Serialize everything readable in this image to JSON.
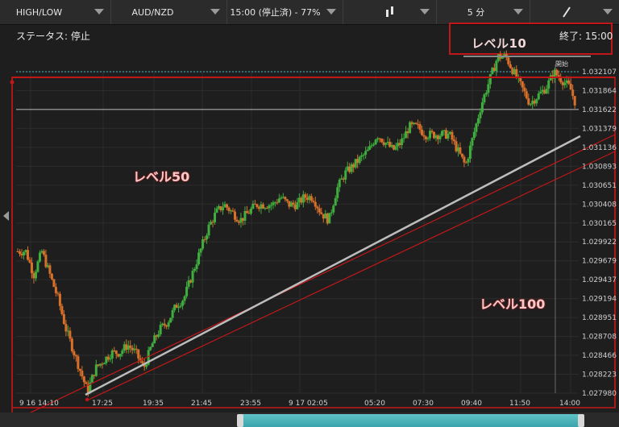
{
  "toolbar": {
    "type_label": "HIGH/LOW",
    "pair_label": "AUD/NZD",
    "expiry_label": "15:00 (停止済) - 77%",
    "timeframe_label": "5 分"
  },
  "status": {
    "status_text": "ステータス: 停止",
    "end_time_text": "終了: 15:00"
  },
  "annotations": {
    "level10": "レベル10",
    "level50": "レベル50",
    "level100": "レベル100",
    "start_marker": "開始"
  },
  "colors": {
    "background": "#1e1e1e",
    "up_candle": "#3fae3f",
    "down_candle": "#d8702a",
    "annotation_red": "#c01818",
    "trend_line": "#bdbdbd",
    "accent_teal": "#4ab4bc"
  },
  "chart_data": {
    "type": "candlestick",
    "title": "",
    "y_ticks": [
      "1.032107",
      "1.031864",
      "1.031622",
      "1.031379",
      "1.031136",
      "1.030893",
      "1.030651",
      "1.030408",
      "1.030165",
      "1.029922",
      "1.029679",
      "1.029437",
      "1.029194",
      "1.028951",
      "1.028708",
      "1.028466",
      "1.028223",
      "1.027980"
    ],
    "x_ticks": [
      "9 16 14:10",
      "17:25",
      "19:35",
      "21:45",
      "23:55",
      "9 17 02:05",
      "05:20",
      "07:30",
      "09:40",
      "11:50",
      "14:00"
    ],
    "ylim": [
      1.02798,
      1.032107
    ],
    "horizontal_lines": [
      1.032107,
      1.031622
    ],
    "price_path": [
      [
        0,
        1.0298
      ],
      [
        3,
        1.0298
      ],
      [
        6,
        1.0295
      ],
      [
        9,
        1.0298
      ],
      [
        12,
        1.0295
      ],
      [
        15,
        1.0292
      ],
      [
        18,
        1.0288
      ],
      [
        21,
        1.0285
      ],
      [
        24,
        1.0282
      ],
      [
        26,
        1.028
      ],
      [
        29,
        1.0283
      ],
      [
        32,
        1.0284
      ],
      [
        35,
        1.0285
      ],
      [
        38,
        1.0285
      ],
      [
        41,
        1.0286
      ],
      [
        44,
        1.0285
      ],
      [
        47,
        1.0283
      ],
      [
        50,
        1.0286
      ],
      [
        53,
        1.0288
      ],
      [
        56,
        1.0289
      ],
      [
        59,
        1.0291
      ],
      [
        62,
        1.0292
      ],
      [
        65,
        1.0295
      ],
      [
        68,
        1.0298
      ],
      [
        71,
        1.0301
      ],
      [
        74,
        1.0303
      ],
      [
        77,
        1.0304
      ],
      [
        80,
        1.0303
      ],
      [
        83,
        1.0302
      ],
      [
        86,
        1.0303
      ],
      [
        89,
        1.0304
      ],
      [
        92,
        1.0304
      ],
      [
        95,
        1.0304
      ],
      [
        98,
        1.0305
      ],
      [
        101,
        1.0304
      ],
      [
        104,
        1.0304
      ],
      [
        107,
        1.0305
      ],
      [
        110,
        1.0305
      ],
      [
        113,
        1.0303
      ],
      [
        116,
        1.0302
      ],
      [
        119,
        1.0306
      ],
      [
        122,
        1.0308
      ],
      [
        125,
        1.0309
      ],
      [
        128,
        1.031
      ],
      [
        131,
        1.0311
      ],
      [
        134,
        1.0313
      ],
      [
        137,
        1.0312
      ],
      [
        140,
        1.0311
      ],
      [
        143,
        1.0312
      ],
      [
        146,
        1.0314
      ],
      [
        149,
        1.0314
      ],
      [
        152,
        1.0313
      ],
      [
        155,
        1.0313
      ],
      [
        158,
        1.0313
      ],
      [
        161,
        1.0313
      ],
      [
        164,
        1.0311
      ],
      [
        167,
        1.0309
      ],
      [
        170,
        1.0313
      ],
      [
        173,
        1.0317
      ],
      [
        176,
        1.032
      ],
      [
        179,
        1.0323
      ],
      [
        182,
        1.0323
      ],
      [
        185,
        1.0321
      ],
      [
        188,
        1.0319
      ],
      [
        191,
        1.0317
      ],
      [
        194,
        1.0318
      ],
      [
        197,
        1.0319
      ],
      [
        200,
        1.0321
      ],
      [
        203,
        1.032
      ],
      [
        206,
        1.0319
      ],
      [
        208,
        1.0317
      ]
    ]
  }
}
